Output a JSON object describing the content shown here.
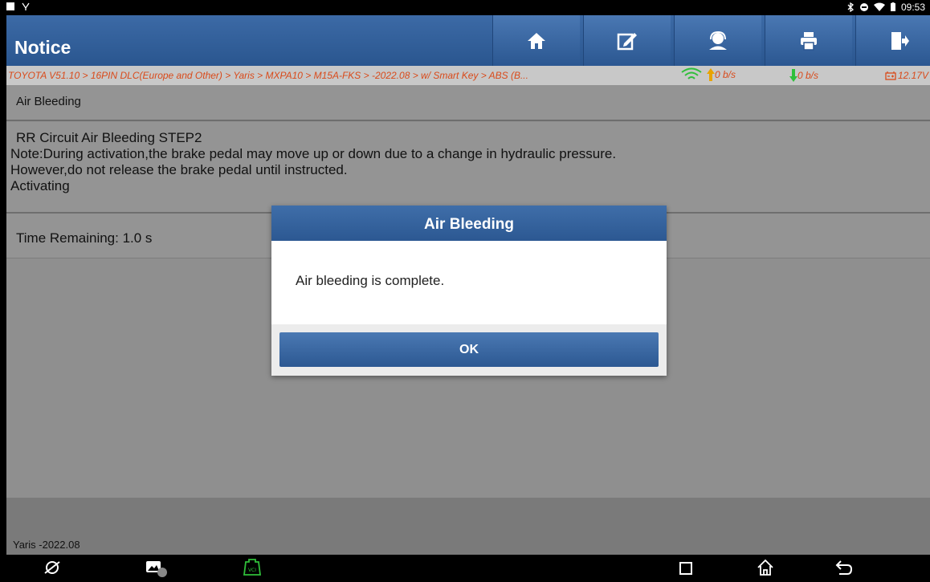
{
  "statusbar": {
    "time": "09:53"
  },
  "header": {
    "title": "Notice"
  },
  "toolbar": {
    "icons": [
      "home-icon",
      "edit-report-icon",
      "remote-support-icon",
      "print-icon",
      "exit-icon"
    ]
  },
  "breadcrumb": {
    "path": "TOYOTA V51.10 > 16PIN DLC(Europe and Other) > Yaris > MXPA10 > M15A-FKS > -2022.08 > w/ Smart Key > ABS (B...",
    "upload_rate": "0 b/s",
    "download_rate": "0 b/s",
    "voltage": "12.17V"
  },
  "content": {
    "section_title": "Air Bleeding",
    "step_lines": [
      "RR Circuit Air Bleeding STEP2",
      "Note:During activation,the brake pedal may move up or down due to a change in hydraulic pressure.",
      "However,do not release the brake pedal until instructed.",
      "Activating"
    ],
    "time_remaining": "Time Remaining: 1.0 s"
  },
  "footer": {
    "vehicle": "Yaris -2022.08"
  },
  "dialog": {
    "title": "Air Bleeding",
    "message": "Air bleeding is complete.",
    "ok_label": "OK"
  },
  "colors": {
    "header_blue": "#2c5892",
    "breadcrumb_text": "#d94a1a",
    "vci_green": "#2fbf3a"
  }
}
